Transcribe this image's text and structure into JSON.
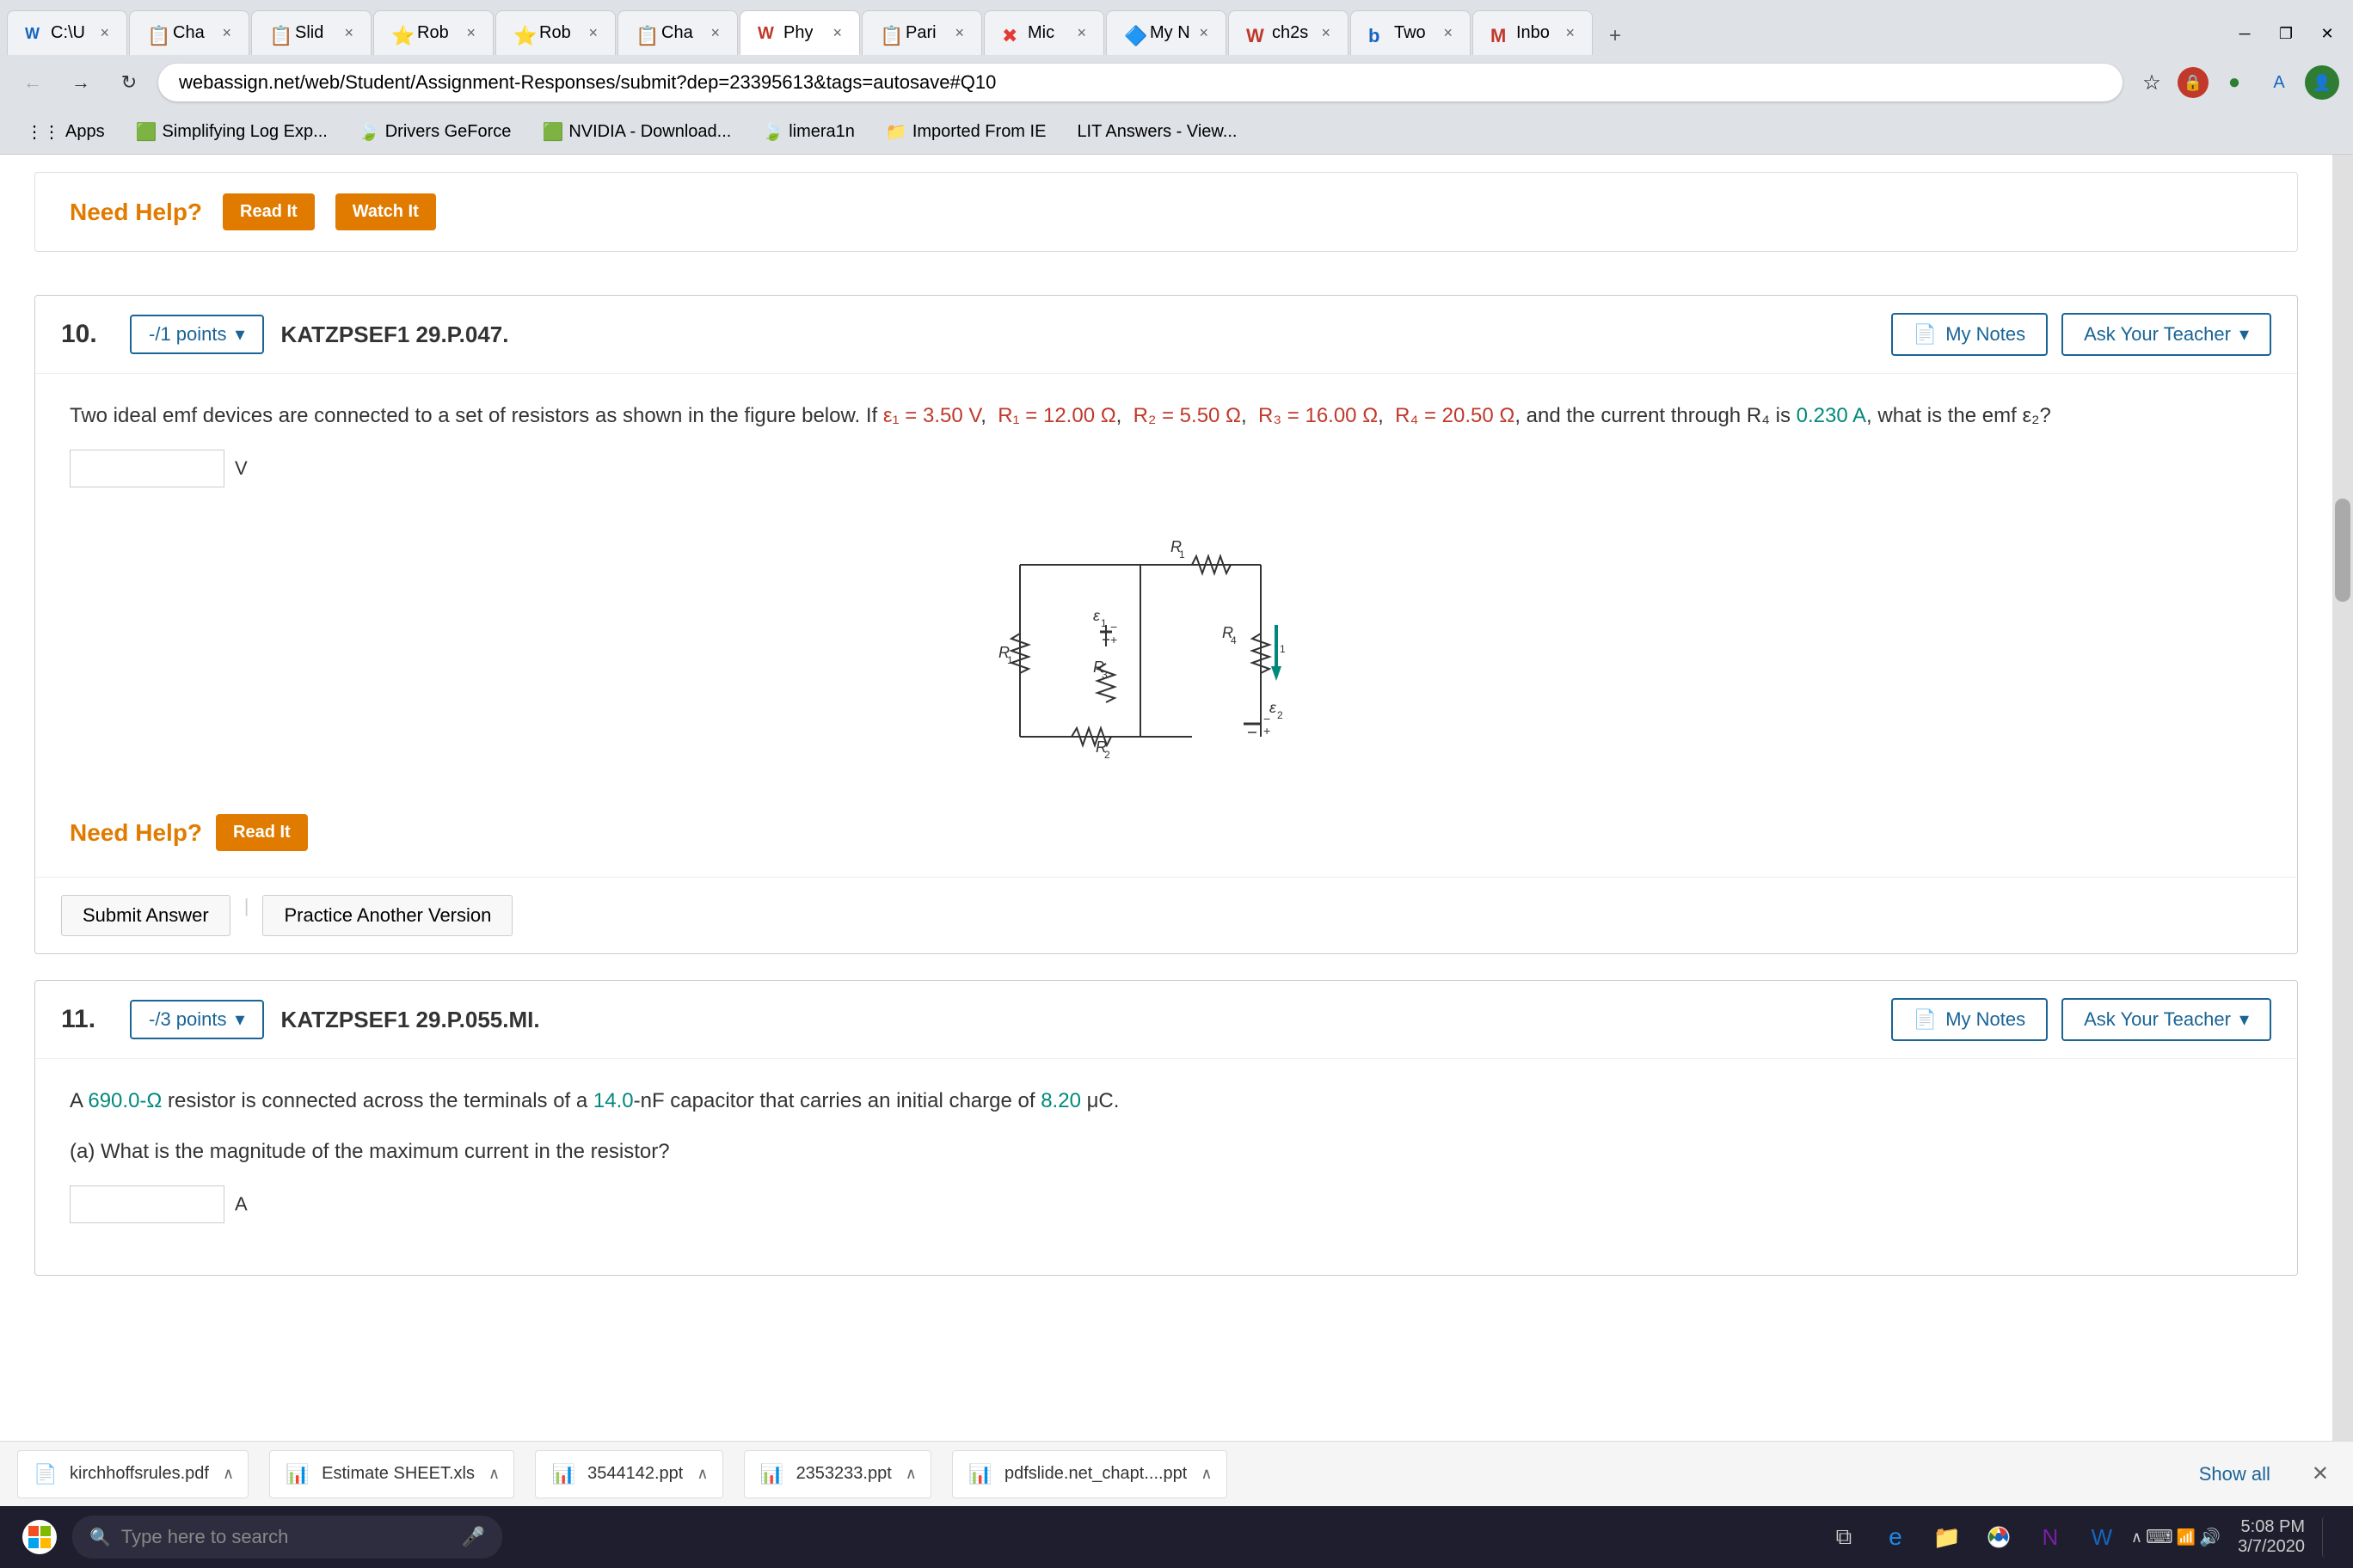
{
  "browser": {
    "tabs": [
      {
        "label": "C:\\U",
        "active": false,
        "favicon": "🔵"
      },
      {
        "label": "Cha",
        "active": false,
        "favicon": "📋"
      },
      {
        "label": "Slid",
        "active": false,
        "favicon": "📋"
      },
      {
        "label": "Rob",
        "active": false,
        "favicon": "⭐"
      },
      {
        "label": "Rob",
        "active": false,
        "favicon": "⭐"
      },
      {
        "label": "Cha",
        "active": false,
        "favicon": "📋"
      },
      {
        "label": "Phy",
        "active": true,
        "favicon": "W"
      },
      {
        "label": "Pari",
        "active": false,
        "favicon": "📋"
      },
      {
        "label": "Mic",
        "active": false,
        "favicon": "✖"
      },
      {
        "label": "My N",
        "active": false,
        "favicon": "🔷"
      },
      {
        "label": "ch2s",
        "active": false,
        "favicon": "W"
      },
      {
        "label": "Two",
        "active": false,
        "favicon": "b"
      },
      {
        "label": "Inbo",
        "active": false,
        "favicon": "M"
      }
    ],
    "url": "webassign.net/web/Student/Assignment-Responses/submit?dep=23395613&tags=autosave#Q10",
    "bookmarks": [
      {
        "label": "Apps",
        "favicon": "⋮⋮⋮"
      },
      {
        "label": "Simplifying Log Exp...",
        "favicon": "🟩"
      },
      {
        "label": "Drivers GeForce",
        "favicon": "🍃"
      },
      {
        "label": "NVIDIA - Download...",
        "favicon": "🟩"
      },
      {
        "label": "limera1n",
        "favicon": "🍃"
      },
      {
        "label": "Imported From IE",
        "favicon": "📁"
      },
      {
        "label": "LIT Answers - View...",
        "favicon": ""
      }
    ]
  },
  "page": {
    "need_help_label": "Need Help?",
    "read_it_btn": "Read It",
    "watch_it_btn": "Watch It",
    "questions": [
      {
        "number": "10.",
        "points": "-/1 points",
        "id": "KATZPSEF1 29.P.047.",
        "my_notes": "My Notes",
        "ask_teacher": "Ask Your Teacher",
        "text_part1": "Two ideal emf devices are connected to a set of resistors as shown in the figure below. If",
        "e1": "ε₁ = 3.50 V",
        "r1": "R₁ = 12.00 Ω",
        "r2": "R₂ = 5.50 Ω",
        "r3": "R₃ = 16.00 Ω",
        "r4": "R₄ = 20.50 Ω",
        "text_part2": "and the current through R₄ is",
        "i4": "0.230 A",
        "text_part3": ", what is the emf ε₂?",
        "unit": "V",
        "need_help_label": "Need Help?",
        "read_it_btn": "Read It",
        "submit_btn": "Submit Answer",
        "practice_btn": "Practice Another Version"
      },
      {
        "number": "11.",
        "points": "-/3 points",
        "id": "KATZPSEF1 29.P.055.MI.",
        "my_notes": "My Notes",
        "ask_teacher": "Ask Your Teacher",
        "text_part1": "A",
        "resistor": "690.0-Ω",
        "text_part2": "resistor is connected across the terminals of a",
        "capacitor": "14.0",
        "text_part3": "-nF capacitor that carries an initial charge of",
        "charge": "8.20",
        "text_part4": "μC.",
        "sub_q": "(a) What is the magnitude of the maximum current in the resistor?",
        "unit": "A"
      }
    ]
  },
  "downloads": [
    {
      "name": "kirchhoffsrules.pdf",
      "icon": "📄",
      "color": "red"
    },
    {
      "name": "Estimate SHEET.xls",
      "icon": "📊",
      "color": "green"
    },
    {
      "name": "3544142.ppt",
      "icon": "📊",
      "color": "red"
    },
    {
      "name": "2353233.ppt",
      "icon": "📊",
      "color": "red"
    },
    {
      "name": "pdfslide.net_chapt....ppt",
      "icon": "📊",
      "color": "red"
    }
  ],
  "downloads_show_all": "Show all",
  "taskbar": {
    "search_placeholder": "Type here to search",
    "time": "5:08 PM",
    "date": "3/7/2020"
  }
}
